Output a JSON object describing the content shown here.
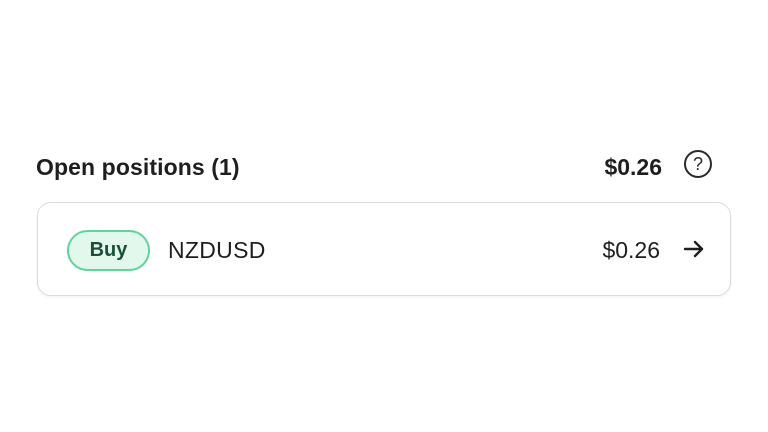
{
  "open_positions": {
    "title": "Open positions (1)",
    "total_pnl": "$0.26",
    "help_icon": "question-circle-icon",
    "help_glyph": "?"
  },
  "positions": [
    {
      "side": "Buy",
      "symbol": "NZDUSD",
      "pnl": "$0.26",
      "action_icon": "arrow-right-icon"
    }
  ],
  "colors": {
    "buy_badge_bg": "#e2f8ec",
    "buy_badge_border": "#5fd49a",
    "buy_badge_text": "#1c4f37",
    "card_border": "#dcdcdc",
    "text_primary": "#1e1e1e"
  }
}
